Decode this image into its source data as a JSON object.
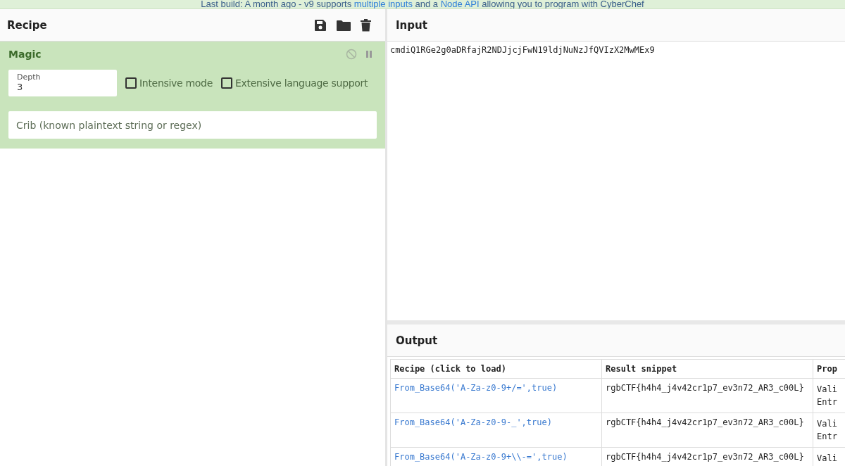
{
  "banner": {
    "text_before": "Last build: A month ago - v9 supports ",
    "link_1": "multiple inputs",
    "text_middle": " and a ",
    "link_2": "Node API",
    "text_after": " allowing you to program with CyberChef"
  },
  "recipe": {
    "title": "Recipe",
    "operation": {
      "name": "Magic",
      "disabled": false,
      "paused": false,
      "depth": {
        "label": "Depth",
        "value": "3"
      },
      "options": [
        {
          "label": "Intensive mode",
          "checked": false
        },
        {
          "label": "Extensive language support",
          "checked": false
        }
      ],
      "crib": {
        "placeholder": "Crib (known plaintext string or regex)"
      }
    }
  },
  "input": {
    "title": "Input",
    "value": "cmdiQ1RGe2g0aDRfajR2NDJjcjFwN19ldjNuNzJfQVIzX2MwMEx9"
  },
  "output": {
    "title": "Output",
    "table": {
      "columns": [
        "Recipe (click to load)",
        "Result snippet",
        "Prop"
      ],
      "rows": [
        {
          "recipe": "From_Base64('A-Za-z0-9+/=',true)",
          "snippet": "rgbCTF{h4h4_j4v42cr1p7_ev3n72_AR3_c00L}",
          "properties": [
            "Vali",
            "Entr"
          ]
        },
        {
          "recipe": "From_Base64('A-Za-z0-9-_',true)",
          "snippet": "rgbCTF{h4h4_j4v42cr1p7_ev3n72_AR3_c00L}",
          "properties": [
            "Vali",
            "Entr"
          ]
        },
        {
          "recipe": "From_Base64('A-Za-z0-9+\\\\-=',true)",
          "snippet": "rgbCTF{h4h4_j4v42cr1p7_ev3n72_AR3_c00L}",
          "properties": [
            "Vali"
          ]
        }
      ]
    }
  }
}
